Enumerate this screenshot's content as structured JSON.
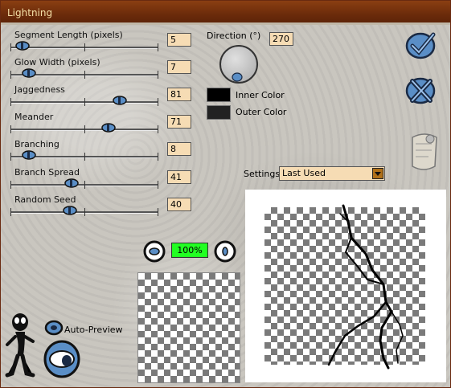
{
  "window": {
    "title": "Lightning"
  },
  "controls": [
    {
      "label": "Segment Length (pixels)",
      "value": "5",
      "pos": 0.03
    },
    {
      "label": "Glow Width (pixels)",
      "value": "7",
      "pos": 0.08
    },
    {
      "label": "Jaggedness",
      "value": "81",
      "pos": 0.77
    },
    {
      "label": "Meander",
      "value": "71",
      "pos": 0.68
    },
    {
      "label": "Branching",
      "value": "8",
      "pos": 0.08
    },
    {
      "label": "Branch Spread",
      "value": "41",
      "pos": 0.4
    },
    {
      "label": "Random Seed",
      "value": "40",
      "pos": 0.39
    }
  ],
  "direction": {
    "label": "Direction (°)",
    "value": "270"
  },
  "colors": {
    "inner_label": "Inner Color",
    "inner": "#000000",
    "outer_label": "Outer Color",
    "outer": "#222222"
  },
  "settings": {
    "label": "Settings:",
    "selected": "Last Used"
  },
  "zoom": {
    "value": "100%"
  },
  "auto_preview": {
    "label": "Auto-Preview"
  },
  "accent": "#5a8ec6"
}
